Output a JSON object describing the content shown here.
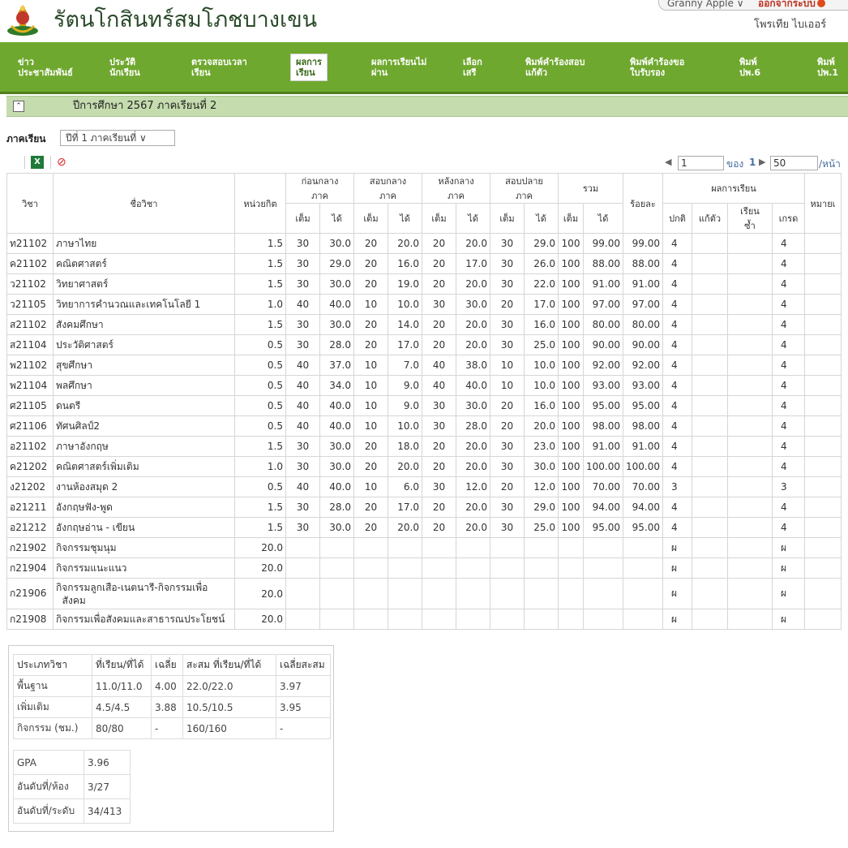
{
  "school": {
    "name": "รัตนโกสินทร์สมโภชบางเขน"
  },
  "top": {
    "user_menu": "Granny Apple ∨",
    "logout": "ออกจากระบบ",
    "username": "โพรเทีย ไบเออร์"
  },
  "nav": {
    "items": [
      {
        "label": "ข่าว\nประชาสัมพันธ์"
      },
      {
        "label": "ประวัติ\nนักเรียน"
      },
      {
        "label": "ตรวจสอบเวลา\nเรียน"
      },
      {
        "label": "ผลการ\nเรียน"
      },
      {
        "label": "ผลการเรียนไม่\nผ่าน"
      },
      {
        "label": "เลือก\nเสรี"
      },
      {
        "label": "พิมพ์คำร้องสอบ\nแก้ตัว"
      },
      {
        "label": "พิมพ์คำร้องขอ\nใบรับรอง"
      },
      {
        "label": "พิมพ์\nปพ.6"
      },
      {
        "label": "พิมพ์\nปพ.1"
      }
    ],
    "active_index": 3
  },
  "yearbar": {
    "text": "ปีการศึกษา 2567 ภาคเรียนที่ 2"
  },
  "semester": {
    "label": "ภาคเรียน",
    "selected": "ปีที่ 1 ภาคเรียนที่ ∨"
  },
  "pager": {
    "page": "1",
    "of_label": "ของ",
    "total": "1",
    "per_page": "50",
    "per_page_label": "/หน้า"
  },
  "table": {
    "headers": {
      "code": "วิชา",
      "name": "ชื่อวิชา",
      "credit": "หน่วยกิต",
      "before_mid": "ก่อนกลาง\nภาค",
      "mid": "สอบกลาง\nภาค",
      "after_mid": "หลังกลาง\nภาค",
      "final": "สอบปลาย\nภาค",
      "total": "รวม",
      "percent": "ร้อยละ",
      "result": "ผลการเรียน",
      "full": "เต็ม",
      "got": "ได้",
      "normal": "ปกติ",
      "fix": "แก้ตัว",
      "repeat": "เรียน\nซ้ำ",
      "grade": "เกรด",
      "note": "หมายเ"
    },
    "rows": [
      {
        "code": "ท21102",
        "name": "ภาษาไทย",
        "credit": "1.5",
        "bf": "30",
        "bg": "30.0",
        "mf": "20",
        "mg": "20.0",
        "af": "20",
        "ag": "20.0",
        "ff": "30",
        "fg": "29.0",
        "tf": "100",
        "tg": "99.00",
        "pct": "99.00",
        "normal": "4",
        "fix": "",
        "repeat": "",
        "grade": "4"
      },
      {
        "code": "ค21102",
        "name": "คณิตศาสตร์",
        "credit": "1.5",
        "bf": "30",
        "bg": "29.0",
        "mf": "20",
        "mg": "16.0",
        "af": "20",
        "ag": "17.0",
        "ff": "30",
        "fg": "26.0",
        "tf": "100",
        "tg": "88.00",
        "pct": "88.00",
        "normal": "4",
        "fix": "",
        "repeat": "",
        "grade": "4"
      },
      {
        "code": "ว21102",
        "name": "วิทยาศาสตร์",
        "credit": "1.5",
        "bf": "30",
        "bg": "30.0",
        "mf": "20",
        "mg": "19.0",
        "af": "20",
        "ag": "20.0",
        "ff": "30",
        "fg": "22.0",
        "tf": "100",
        "tg": "91.00",
        "pct": "91.00",
        "normal": "4",
        "fix": "",
        "repeat": "",
        "grade": "4"
      },
      {
        "code": "ว21105",
        "name": "วิทยาการคำนวณและเทคโนโลยี 1",
        "credit": "1.0",
        "bf": "40",
        "bg": "40.0",
        "mf": "10",
        "mg": "10.0",
        "af": "30",
        "ag": "30.0",
        "ff": "20",
        "fg": "17.0",
        "tf": "100",
        "tg": "97.00",
        "pct": "97.00",
        "normal": "4",
        "fix": "",
        "repeat": "",
        "grade": "4"
      },
      {
        "code": "ส21102",
        "name": "สังคมศึกษา",
        "credit": "1.5",
        "bf": "30",
        "bg": "30.0",
        "mf": "20",
        "mg": "14.0",
        "af": "20",
        "ag": "20.0",
        "ff": "30",
        "fg": "16.0",
        "tf": "100",
        "tg": "80.00",
        "pct": "80.00",
        "normal": "4",
        "fix": "",
        "repeat": "",
        "grade": "4"
      },
      {
        "code": "ส21104",
        "name": "ประวัติศาสตร์",
        "credit": "0.5",
        "bf": "30",
        "bg": "28.0",
        "mf": "20",
        "mg": "17.0",
        "af": "20",
        "ag": "20.0",
        "ff": "30",
        "fg": "25.0",
        "tf": "100",
        "tg": "90.00",
        "pct": "90.00",
        "normal": "4",
        "fix": "",
        "repeat": "",
        "grade": "4"
      },
      {
        "code": "พ21102",
        "name": "สุขศึกษา",
        "credit": "0.5",
        "bf": "40",
        "bg": "37.0",
        "mf": "10",
        "mg": "7.0",
        "af": "40",
        "ag": "38.0",
        "ff": "10",
        "fg": "10.0",
        "tf": "100",
        "tg": "92.00",
        "pct": "92.00",
        "normal": "4",
        "fix": "",
        "repeat": "",
        "grade": "4"
      },
      {
        "code": "พ21104",
        "name": "พลศึกษา",
        "credit": "0.5",
        "bf": "40",
        "bg": "34.0",
        "mf": "10",
        "mg": "9.0",
        "af": "40",
        "ag": "40.0",
        "ff": "10",
        "fg": "10.0",
        "tf": "100",
        "tg": "93.00",
        "pct": "93.00",
        "normal": "4",
        "fix": "",
        "repeat": "",
        "grade": "4"
      },
      {
        "code": "ศ21105",
        "name": "ดนตรี",
        "credit": "0.5",
        "bf": "40",
        "bg": "40.0",
        "mf": "10",
        "mg": "9.0",
        "af": "30",
        "ag": "30.0",
        "ff": "20",
        "fg": "16.0",
        "tf": "100",
        "tg": "95.00",
        "pct": "95.00",
        "normal": "4",
        "fix": "",
        "repeat": "",
        "grade": "4"
      },
      {
        "code": "ศ21106",
        "name": "ทัศนศิลป์2",
        "credit": "0.5",
        "bf": "40",
        "bg": "40.0",
        "mf": "10",
        "mg": "10.0",
        "af": "30",
        "ag": "28.0",
        "ff": "20",
        "fg": "20.0",
        "tf": "100",
        "tg": "98.00",
        "pct": "98.00",
        "normal": "4",
        "fix": "",
        "repeat": "",
        "grade": "4"
      },
      {
        "code": "อ21102",
        "name": "ภาษาอังกฤษ",
        "credit": "1.5",
        "bf": "30",
        "bg": "30.0",
        "mf": "20",
        "mg": "18.0",
        "af": "20",
        "ag": "20.0",
        "ff": "30",
        "fg": "23.0",
        "tf": "100",
        "tg": "91.00",
        "pct": "91.00",
        "normal": "4",
        "fix": "",
        "repeat": "",
        "grade": "4"
      },
      {
        "code": "ค21202",
        "name": "คณิตศาสตร์เพิ่มเติม",
        "credit": "1.0",
        "bf": "30",
        "bg": "30.0",
        "mf": "20",
        "mg": "20.0",
        "af": "20",
        "ag": "20.0",
        "ff": "30",
        "fg": "30.0",
        "tf": "100",
        "tg": "100.00",
        "pct": "100.00",
        "normal": "4",
        "fix": "",
        "repeat": "",
        "grade": "4"
      },
      {
        "code": "ง21202",
        "name": "งานห้องสมุด 2",
        "credit": "0.5",
        "bf": "40",
        "bg": "40.0",
        "mf": "10",
        "mg": "6.0",
        "af": "30",
        "ag": "12.0",
        "ff": "20",
        "fg": "12.0",
        "tf": "100",
        "tg": "70.00",
        "pct": "70.00",
        "normal": "3",
        "fix": "",
        "repeat": "",
        "grade": "3"
      },
      {
        "code": "อ21211",
        "name": "อังกฤษฟัง-พูด",
        "credit": "1.5",
        "bf": "30",
        "bg": "28.0",
        "mf": "20",
        "mg": "17.0",
        "af": "20",
        "ag": "20.0",
        "ff": "30",
        "fg": "29.0",
        "tf": "100",
        "tg": "94.00",
        "pct": "94.00",
        "normal": "4",
        "fix": "",
        "repeat": "",
        "grade": "4"
      },
      {
        "code": "อ21212",
        "name": "อังกฤษอ่าน - เขียน",
        "credit": "1.5",
        "bf": "30",
        "bg": "30.0",
        "mf": "20",
        "mg": "20.0",
        "af": "20",
        "ag": "20.0",
        "ff": "30",
        "fg": "25.0",
        "tf": "100",
        "tg": "95.00",
        "pct": "95.00",
        "normal": "4",
        "fix": "",
        "repeat": "",
        "grade": "4"
      },
      {
        "code": "ก21902",
        "name": "กิจกรรมชุมนุม",
        "credit": "20.0",
        "bf": "",
        "bg": "",
        "mf": "",
        "mg": "",
        "af": "",
        "ag": "",
        "ff": "",
        "fg": "",
        "tf": "",
        "tg": "",
        "pct": "",
        "normal": "ผ",
        "fix": "",
        "repeat": "",
        "grade": "ผ"
      },
      {
        "code": "ก21904",
        "name": "กิจกรรมแนะแนว",
        "credit": "20.0",
        "bf": "",
        "bg": "",
        "mf": "",
        "mg": "",
        "af": "",
        "ag": "",
        "ff": "",
        "fg": "",
        "tf": "",
        "tg": "",
        "pct": "",
        "normal": "ผ",
        "fix": "",
        "repeat": "",
        "grade": "ผ"
      },
      {
        "code": "ก21906",
        "name": "กิจกรรมลูกเสือ-เนตนารี-กิจกรรมเพื่อ\n  สังคม",
        "credit": "20.0",
        "bf": "",
        "bg": "",
        "mf": "",
        "mg": "",
        "af": "",
        "ag": "",
        "ff": "",
        "fg": "",
        "tf": "",
        "tg": "",
        "pct": "",
        "normal": "ผ",
        "fix": "",
        "repeat": "",
        "grade": "ผ",
        "tall": true
      },
      {
        "code": "ก21908",
        "name": "กิจกรรมเพื่อสังคมและสาธารณประโยชน์",
        "credit": "20.0",
        "bf": "",
        "bg": "",
        "mf": "",
        "mg": "",
        "af": "",
        "ag": "",
        "ff": "",
        "fg": "",
        "tf": "",
        "tg": "",
        "pct": "",
        "normal": "ผ",
        "fix": "",
        "repeat": "",
        "grade": "ผ"
      }
    ]
  },
  "summary": {
    "headers": {
      "type": "ประเภทวิชา",
      "studied": "ที่เรียน/ที่ได้",
      "avg": "เฉลี่ย",
      "cum": "สะสม ที่เรียน/ที่ได้",
      "cum_avg": "เฉลี่ยสะสม"
    },
    "rows": [
      {
        "type": "พื้นฐาน",
        "studied": "11.0/11.0",
        "avg": "4.00",
        "cum": "22.0/22.0",
        "cum_avg": "3.97"
      },
      {
        "type": "เพิ่มเติม",
        "studied": "4.5/4.5",
        "avg": "3.88",
        "cum": "10.5/10.5",
        "cum_avg": "3.95"
      },
      {
        "type": "กิจกรรม (ชม.)",
        "studied": "80/80",
        "avg": "-",
        "cum": "160/160",
        "cum_avg": "-"
      }
    ],
    "gpa": {
      "label": "GPA",
      "value": "3.96"
    },
    "rank_room": {
      "label": "อันดับที่/ห้อง",
      "value": "3/27"
    },
    "rank_level": {
      "label": "อันดับที่/ระดับ",
      "value": "34/413"
    }
  }
}
